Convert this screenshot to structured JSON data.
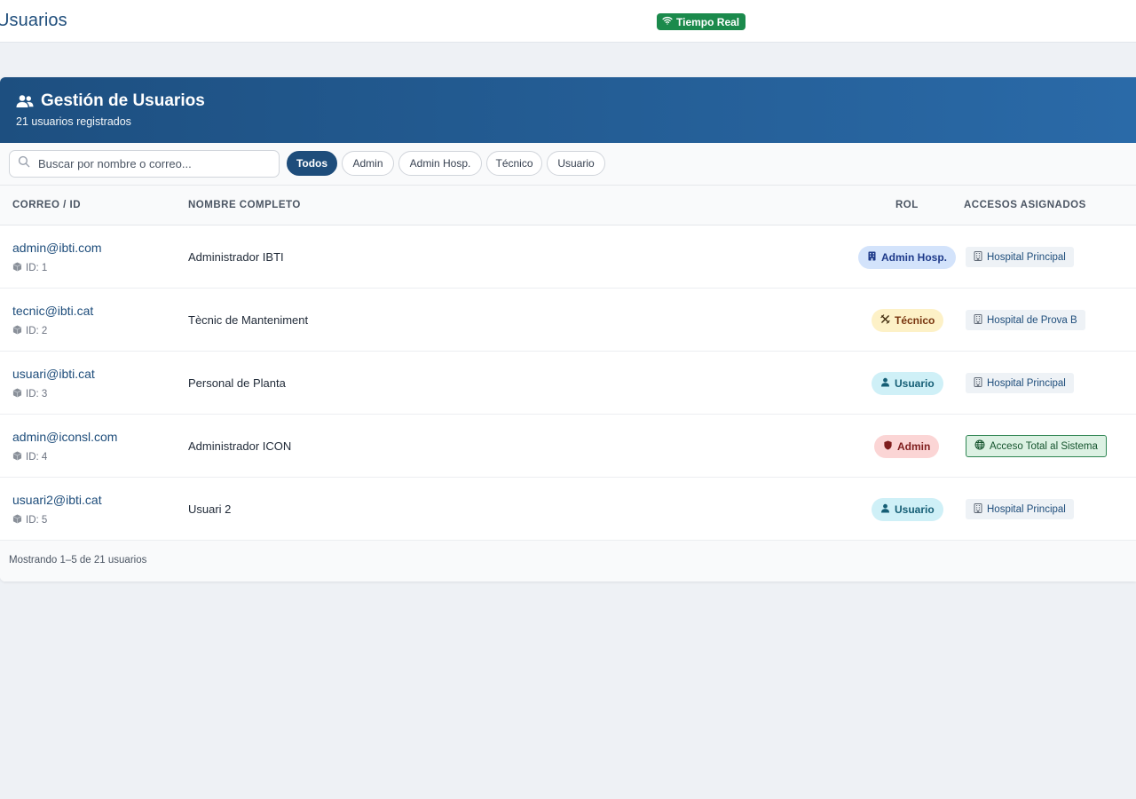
{
  "topbar": {
    "title": "Usuarios",
    "live_badge": "Tiempo Real",
    "live_icon": "wifi-icon"
  },
  "card": {
    "title": "Gestión de Usuarios",
    "subtitle": "21 usuarios registrados",
    "title_icon": "users-icon"
  },
  "search": {
    "placeholder": "Buscar por nombre o correo...",
    "value": ""
  },
  "filters": [
    {
      "label": "Todos",
      "active": true
    },
    {
      "label": "Admin",
      "active": false
    },
    {
      "label": "Admin Hosp.",
      "active": false
    },
    {
      "label": "Técnico",
      "active": false
    },
    {
      "label": "Usuario",
      "active": false
    }
  ],
  "table": {
    "headers": {
      "email": "CORREO / ID",
      "name": "NOMBRE COMPLETO",
      "role": "ROL",
      "access": "ACCESOS ASIGNADOS"
    },
    "rows": [
      {
        "email": "admin@ibti.com",
        "id": "ID: 1",
        "name": "Administrador IBTI",
        "role": "Admin Hosp.",
        "role_icon": "building-icon",
        "access": "Hospital Principal",
        "access_icon": "building-icon"
      },
      {
        "email": "tecnic@ibti.cat",
        "id": "ID: 2",
        "name": "Tècnic de Manteniment",
        "role": "Técnico",
        "role_icon": "tools-icon",
        "access": "Hospital de Prova B",
        "access_icon": "building-icon"
      },
      {
        "email": "usuari@ibti.cat",
        "id": "ID: 3",
        "name": "Personal de Planta",
        "role": "Usuario",
        "role_icon": "user-icon",
        "access": "Hospital Principal",
        "access_icon": "building-icon"
      },
      {
        "email": "admin@iconsl.com",
        "id": "ID: 4",
        "name": "Administrador ICON",
        "role": "Admin",
        "role_icon": "shield-icon",
        "access": "Acceso Total al Sistema",
        "access_icon": "globe-icon"
      },
      {
        "email": "usuari2@ibti.cat",
        "id": "ID: 5",
        "name": "Usuari 2",
        "role": "Usuario",
        "role_icon": "user-icon",
        "access": "Hospital Principal",
        "access_icon": "building-icon"
      }
    ]
  },
  "footer": {
    "text": "Mostrando 1–5 de 21 usuarios"
  },
  "colors": {
    "primary": "#1e4d7b",
    "live_green": "#1b8a4c",
    "header_gradient_start": "#1d4f80",
    "header_gradient_end": "#2a6aa8",
    "role_admin_hosp": "#d3e3fb",
    "role_tecnico": "#fdf1c7",
    "role_usuario": "#cff0f7",
    "role_admin": "#fbd5d5",
    "access_total": "#dcf1e3"
  }
}
